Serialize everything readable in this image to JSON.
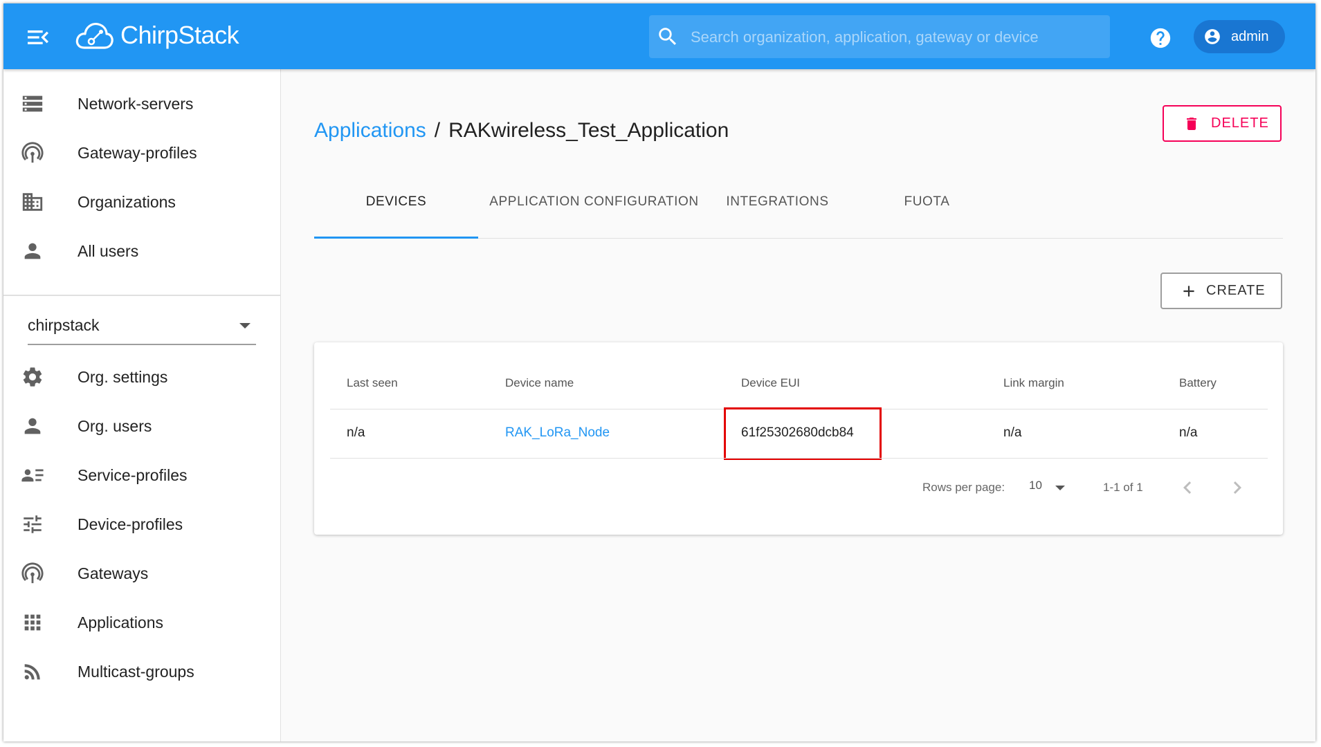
{
  "header": {
    "app_name": "ChirpStack",
    "search_placeholder": "Search organization, application, gateway or device",
    "user_label": "admin"
  },
  "sidebar": {
    "admin_items": [
      {
        "label": "Network-servers",
        "icon": "server-icon"
      },
      {
        "label": "Gateway-profiles",
        "icon": "antenna-icon"
      },
      {
        "label": "Organizations",
        "icon": "building-icon"
      },
      {
        "label": "All users",
        "icon": "person-icon"
      }
    ],
    "organization": "chirpstack",
    "org_items": [
      {
        "label": "Org. settings",
        "icon": "gear-icon"
      },
      {
        "label": "Org. users",
        "icon": "person-icon"
      },
      {
        "label": "Service-profiles",
        "icon": "contacts-list-icon"
      },
      {
        "label": "Device-profiles",
        "icon": "tune-sliders-icon"
      },
      {
        "label": "Gateways",
        "icon": "antenna-icon"
      },
      {
        "label": "Applications",
        "icon": "apps-grid-icon"
      },
      {
        "label": "Multicast-groups",
        "icon": "rss-feed-icon"
      }
    ]
  },
  "main": {
    "breadcrumb_parent": "Applications",
    "breadcrumb_separator": "/",
    "breadcrumb_current": "RAKwireless_Test_Application",
    "delete_label": "DELETE",
    "create_label": "CREATE",
    "tabs": [
      "DEVICES",
      "APPLICATION CONFIGURATION",
      "INTEGRATIONS",
      "FUOTA"
    ],
    "active_tab": "DEVICES",
    "table": {
      "columns": [
        "Last seen",
        "Device name",
        "Device EUI",
        "Link margin",
        "Battery"
      ],
      "rows": [
        {
          "last_seen": "n/a",
          "device_name": "RAK_LoRa_Node",
          "device_eui": "61f25302680dcb84",
          "link_margin": "n/a",
          "battery": "n/a"
        }
      ]
    },
    "pagination": {
      "rows_per_page_label": "Rows per page:",
      "rows_per_page": "10",
      "range": "1-1 of 1"
    },
    "highlight_color": "#e30000",
    "accent_color": "#2196f3",
    "danger_color": "#f50057"
  }
}
